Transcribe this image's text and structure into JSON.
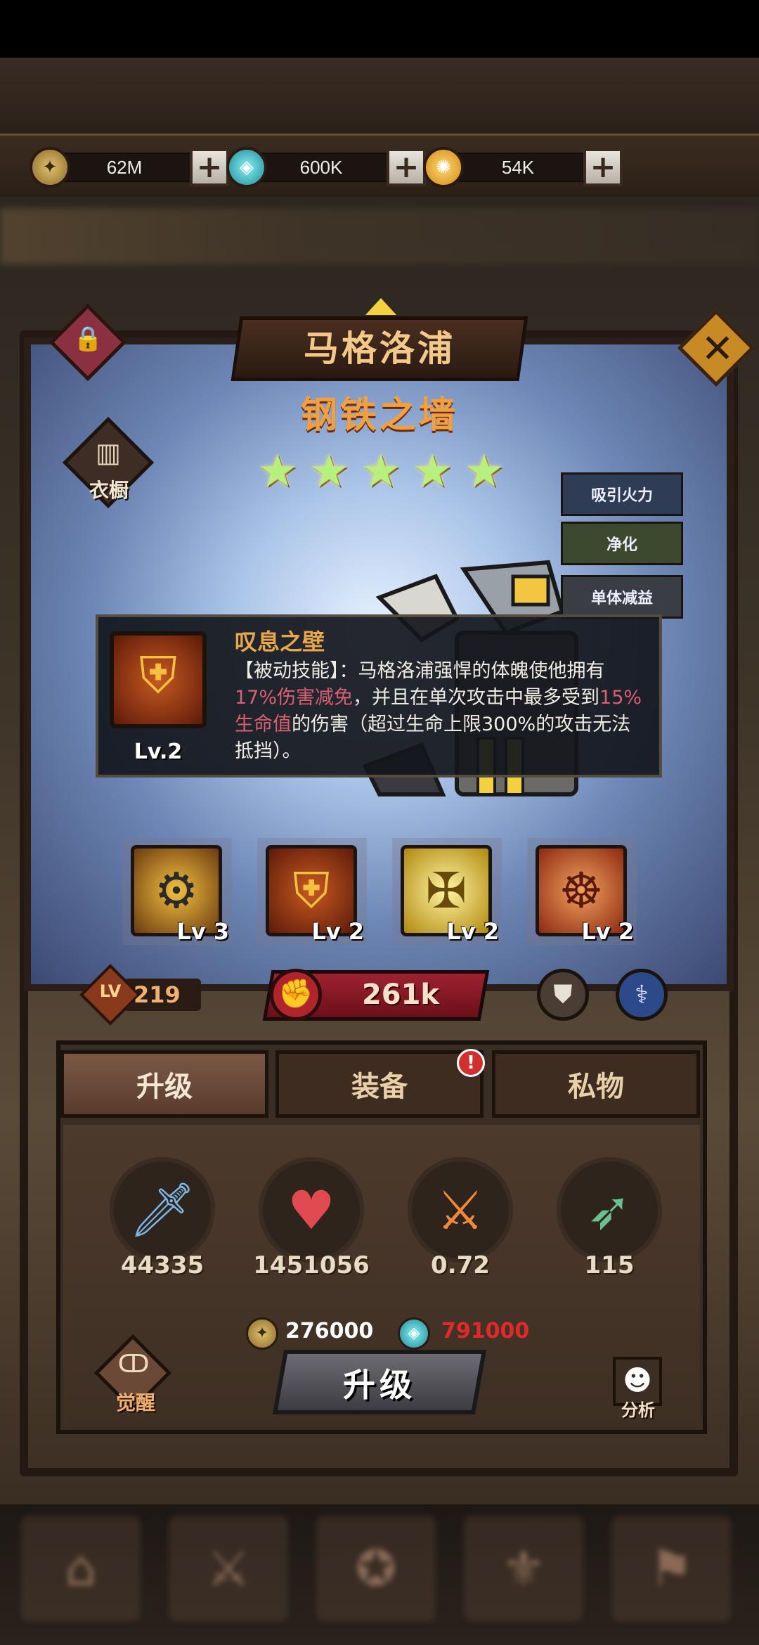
{
  "currency": {
    "gold": {
      "icon": "gold-coin-icon",
      "value": "62M"
    },
    "gem": {
      "icon": "crystal-gem-icon",
      "value": "600K"
    },
    "energy": {
      "icon": "energy-orb-icon",
      "value": "54K"
    }
  },
  "hero": {
    "name": "马格洛浦",
    "title": "钢铁之墙",
    "stars": 5,
    "wardrobe_label": "衣橱",
    "tags": [
      "吸引火力",
      "净化",
      "单体减益"
    ]
  },
  "tooltip": {
    "skill_name": "叹息之壁",
    "level": "Lv.2",
    "desc_part1": "【被动技能】：马格洛浦强悍的体魄使他拥有",
    "desc_hl1": "17%伤害减免",
    "desc_part2": "，并且在单次攻击中最多受到",
    "desc_hl2": "15%生命值",
    "desc_part3": "的伤害（超过生命上限300%的攻击无法抵挡）。"
  },
  "skills": [
    {
      "icon": "spiked-flail-icon",
      "level": "Lv 3"
    },
    {
      "icon": "shield-crest-icon",
      "level": "Lv 2"
    },
    {
      "icon": "winged-cross-icon",
      "level": "Lv 2"
    },
    {
      "icon": "octopus-demon-icon",
      "level": "Lv 2"
    }
  ],
  "level": {
    "label": "LV",
    "value": "219"
  },
  "power": {
    "value": "261k"
  },
  "tabs": {
    "upgrade": "升级",
    "equipment": "装备",
    "private": "私物",
    "equipment_alert": "!"
  },
  "stats": [
    {
      "icon": "sword-icon",
      "value": "44335"
    },
    {
      "icon": "heart-icon",
      "value": "1451056"
    },
    {
      "icon": "crit-slash-icon",
      "value": "0.72"
    },
    {
      "icon": "arrow-icon",
      "value": "115"
    }
  ],
  "cost": {
    "gold": {
      "value": "276000",
      "color": "#ffffff"
    },
    "gem": {
      "value": "791000",
      "color": "#e02a2a"
    }
  },
  "buttons": {
    "upgrade": "升级",
    "awaken": "觉醒",
    "analyze": "分析"
  },
  "colors": {
    "highlight": "#d86070",
    "power_red": "#9e2230",
    "title_orange": "#f0a040"
  }
}
